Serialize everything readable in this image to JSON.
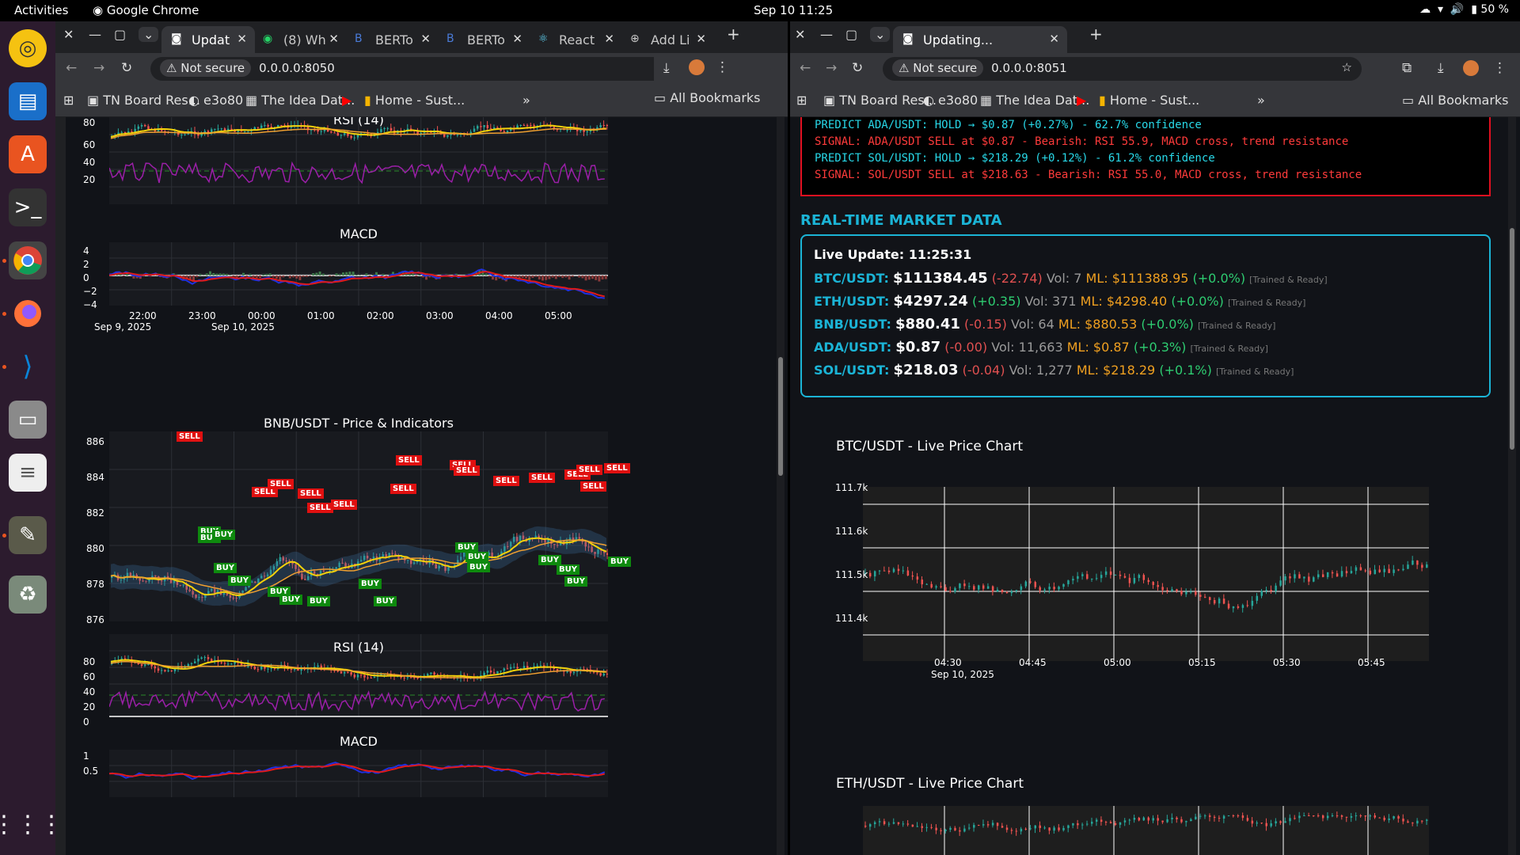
{
  "topbar": {
    "activities": "Activities",
    "app": "Google Chrome",
    "clock": "Sep 10  11:25",
    "battery": "50 %"
  },
  "dock": {
    "items": [
      "rhythmbox-icon",
      "writer-icon",
      "software-icon",
      "terminal-icon",
      "chrome-icon",
      "firefox-icon",
      "vscode-icon",
      "files-icon",
      "text-editor-icon",
      "gimp-icon",
      "trash-icon",
      "apps-grid-icon"
    ]
  },
  "left": {
    "tabs": [
      {
        "label": "Updat"
      },
      {
        "label": "(8) Wh"
      },
      {
        "label": "BERTo"
      },
      {
        "label": "BERTo"
      },
      {
        "label": "React"
      },
      {
        "label": "Add Li"
      }
    ],
    "url_security": "Not secure",
    "url": "0.0.0.0:8050",
    "bookmarks": [
      "TN Board Res...",
      "e3o80",
      "The Idea Dat...",
      "",
      "Home - Sust..."
    ],
    "all_bookmarks": "All Bookmarks",
    "rsi_title": "RSI (14)",
    "rsi_ticks": [
      "80",
      "60",
      "40",
      "20"
    ],
    "macd_title": "MACD",
    "macd_ticks": [
      "4",
      "2",
      "0",
      "−2",
      "−4"
    ],
    "macd_x": [
      "22:00",
      "23:00",
      "00:00",
      "01:00",
      "02:00",
      "03:00",
      "04:00",
      "05:00"
    ],
    "macd_x2": [
      "Sep 9, 2025",
      "Sep 10, 2025"
    ],
    "bnb_title": "BNB/USDT - Price & Indicators",
    "bnb_ticks": [
      "886",
      "884",
      "882",
      "880",
      "878",
      "876"
    ],
    "rsi2_title": "RSI (14)",
    "rsi2_ticks": [
      "80",
      "60",
      "40",
      "20",
      "0"
    ],
    "macd2_title": "MACD",
    "macd2_ticks": [
      "1",
      "0.5"
    ],
    "sell": "SELL",
    "buy": "BUY"
  },
  "right": {
    "tab": "Updating...",
    "url_security": "Not secure",
    "url": "0.0.0.0:8051",
    "bookmarks": [
      "TN Board Res...",
      "e3o80",
      "The Idea Dat...",
      "",
      "Home - Sust..."
    ],
    "all_bookmarks": "All Bookmarks",
    "log": [
      {
        "text": "PREDICT ADA/USDT: HOLD → $0.87 (+0.27%) - 62.7% confidence",
        "color": "#28d8e8"
      },
      {
        "text": "SIGNAL: ADA/USDT SELL at $0.87 - Bearish: RSI 55.9, MACD cross, trend resistance",
        "color": "#ff3b3b"
      },
      {
        "text": "PREDICT SOL/USDT: HOLD → $218.29 (+0.12%) - 61.2% confidence",
        "color": "#28d8e8"
      },
      {
        "text": "SIGNAL: SOL/USDT SELL at $218.63 - Bearish: RSI 55.0, MACD cross, trend resistance",
        "color": "#ff3b3b"
      }
    ],
    "section_title": "REAL-TIME MARKET DATA",
    "live_update": "Live Update: 11:25:31",
    "rows": [
      {
        "sym": "BTC/USDT:",
        "price": "$111384.45",
        "chg": "(-22.74)",
        "chg_class": "neg",
        "vol": "Vol: 7",
        "ml": "ML: $111388.95",
        "mlchg": "(+0.0%)",
        "tag": "[Trained & Ready]"
      },
      {
        "sym": "ETH/USDT:",
        "price": "$4297.24",
        "chg": "(+0.35)",
        "chg_class": "pos",
        "vol": "Vol: 371",
        "ml": "ML: $4298.40",
        "mlchg": "(+0.0%)",
        "tag": "[Trained & Ready]"
      },
      {
        "sym": "BNB/USDT:",
        "price": "$880.41",
        "chg": "(-0.15)",
        "chg_class": "neg",
        "vol": "Vol: 64",
        "ml": "ML: $880.53",
        "mlchg": "(+0.0%)",
        "tag": "[Trained & Ready]"
      },
      {
        "sym": "ADA/USDT:",
        "price": "$0.87",
        "chg": "(-0.00)",
        "chg_class": "neg",
        "vol": "Vol: 11,663",
        "ml": "ML: $0.87",
        "mlchg": "(+0.3%)",
        "tag": "[Trained & Ready]"
      },
      {
        "sym": "SOL/USDT:",
        "price": "$218.03",
        "chg": "(-0.04)",
        "chg_class": "neg",
        "vol": "Vol: 1,277",
        "ml": "ML: $218.29",
        "mlchg": "(+0.1%)",
        "tag": "[Trained & Ready]"
      }
    ],
    "btc_title": "BTC/USDT - Live Price Chart",
    "btc_yticks": [
      "111.7k",
      "111.6k",
      "111.5k",
      "111.4k"
    ],
    "btc_xticks": [
      "04:30",
      "04:45",
      "05:00",
      "05:15",
      "05:30",
      "05:45"
    ],
    "btc_xdate": "Sep 10, 2025",
    "eth_title": "ETH/USDT - Live Price Chart"
  },
  "colors": {
    "accent": "#1bb4d6",
    "sell": "#e01010",
    "buy": "#0e8a0e",
    "up": "#26a69a",
    "down": "#ef5350"
  }
}
